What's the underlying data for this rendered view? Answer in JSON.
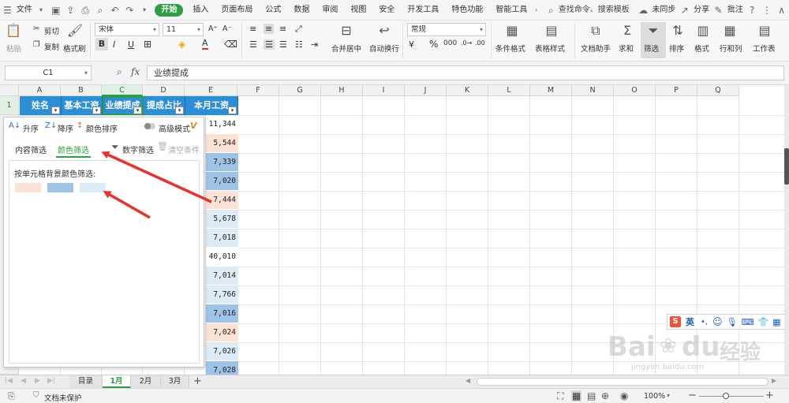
{
  "menu": {
    "file": "文件",
    "tabs": [
      "开始",
      "插入",
      "页面布局",
      "公式",
      "数据",
      "审阅",
      "视图",
      "安全",
      "开发工具",
      "特色功能",
      "智能工具"
    ],
    "search_placeholder": "查找命令、搜索模板",
    "sync": "未同步",
    "share": "分享",
    "annotate": "批注"
  },
  "ribbon": {
    "paste": "粘贴",
    "cut": "剪切",
    "copy": "复制",
    "format_painter": "格式刷",
    "font_name": "宋体",
    "font_size": "11",
    "number_format": "常规",
    "merge_center": "合并居中",
    "wrap": "自动换行",
    "cond_format": "条件格式",
    "table_style": "表格样式",
    "doc_assistant": "文档助手",
    "sum": "求和",
    "filter": "筛选",
    "sort": "排序",
    "format": "格式",
    "row_col": "行和列",
    "worksheet": "工作表",
    "bold": "B",
    "italic": "I",
    "underline": "U",
    "font_color_letter": "A"
  },
  "formula_bar": {
    "cell_ref": "C1",
    "fx": "fx",
    "content": "业绩提成"
  },
  "columns": [
    "A",
    "B",
    "C",
    "D",
    "E",
    "F",
    "G",
    "H",
    "I",
    "J",
    "K",
    "L",
    "M",
    "N",
    "O",
    "P",
    "Q"
  ],
  "row1_label": "1",
  "header_row": [
    "姓名",
    "基本工资",
    "业绩提成",
    "提成占比",
    "本月工资"
  ],
  "col_e_values": [
    {
      "v": "11,344",
      "c": "#ffffff"
    },
    {
      "v": "5,544",
      "c": "#fbe2d5"
    },
    {
      "v": "7,339",
      "c": "#9dc3e6"
    },
    {
      "v": "7,020",
      "c": "#9dc3e6"
    },
    {
      "v": "7,444",
      "c": "#fbe2d5"
    },
    {
      "v": "5,678",
      "c": "#ddebf7"
    },
    {
      "v": "7,018",
      "c": "#ddebf7"
    },
    {
      "v": "40,010",
      "c": "#ffffff"
    },
    {
      "v": "7,014",
      "c": "#ddebf7"
    },
    {
      "v": "7,766",
      "c": "#ddebf7"
    },
    {
      "v": "7,016",
      "c": "#9dc3e6"
    },
    {
      "v": "7,024",
      "c": "#fbe2d5"
    },
    {
      "v": "7,026",
      "c": "#ddebf7"
    },
    {
      "v": "7,028",
      "c": "#9dc3e6"
    }
  ],
  "filter_panel": {
    "asc": "升序",
    "desc": "降序",
    "color_sort": "颜色排序",
    "advanced": "高级模式",
    "tab_content": "内容筛选",
    "tab_color": "颜色筛选",
    "number_filter": "数字筛选",
    "clear": "清空条件",
    "color_label": "按单元格背景颜色筛选:",
    "swatches": [
      "#fbe2d5",
      "#9dc3e6",
      "#ddebf7"
    ]
  },
  "sheets": [
    "目录",
    "1月",
    "2月",
    "3月"
  ],
  "add_sheet": "+",
  "status": {
    "protect": "文档未保护",
    "zoom": "100%",
    "minus": "−",
    "plus": "+"
  },
  "ime": {
    "label": "英"
  },
  "watermark": {
    "brand": "Bai",
    "brand2": "du",
    "cn": "经验",
    "url": "jingyan.baidu.com"
  },
  "colors": {
    "accent_green": "#2e9e44",
    "header_blue": "#2b8fd7",
    "arrow_red": "#e8322b"
  }
}
